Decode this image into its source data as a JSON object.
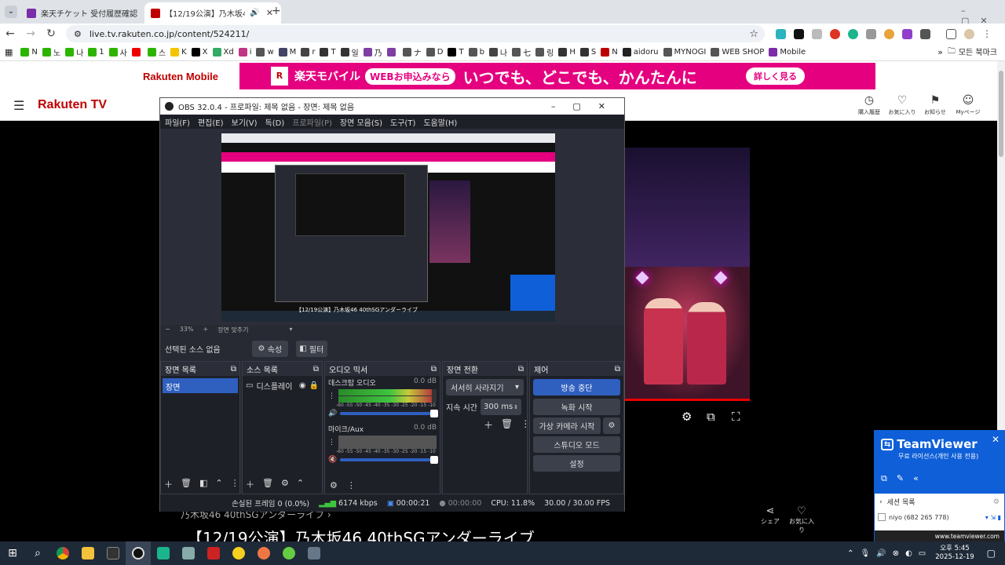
{
  "browser": {
    "tabs": [
      {
        "title": "楽天チケット 受付履歴確認 ·",
        "favicon_color": "#7b2ca8",
        "active": false
      },
      {
        "title": "【12/19公演】乃木坂46 40th",
        "favicon_color": "#bf0000",
        "active": true,
        "audio_icon": "speaker-icon"
      }
    ],
    "new_tab_label": "+",
    "url": "live.tv.rakuten.co.jp/content/524211/",
    "bookmarks": [
      {
        "label": "N",
        "color": "#2db400"
      },
      {
        "label": "노",
        "color": "#2db400"
      },
      {
        "label": "나",
        "color": "#2db400"
      },
      {
        "label": "1",
        "color": "#2db400"
      },
      {
        "label": "사",
        "color": "#2db400"
      },
      {
        "label": "",
        "color": "#e00"
      },
      {
        "label": "스",
        "color": "#2db400"
      },
      {
        "label": "K",
        "color": "#f5c400"
      },
      {
        "label": "X",
        "color": "#000"
      },
      {
        "label": "Xd",
        "color": "#3a6"
      },
      {
        "label": "i",
        "color": "#c13584"
      },
      {
        "label": "w",
        "color": "#555"
      },
      {
        "label": "M",
        "color": "#446"
      },
      {
        "label": "r",
        "color": "#444"
      },
      {
        "label": "T",
        "color": "#333"
      },
      {
        "label": "일",
        "color": "#333"
      },
      {
        "label": "乃",
        "color": "#7e3fa0"
      },
      {
        "label": "",
        "color": "#7e3fa0"
      },
      {
        "label": "ナ",
        "color": "#555"
      },
      {
        "label": "D",
        "color": "#555"
      },
      {
        "label": "T",
        "color": "#000"
      },
      {
        "label": "b",
        "color": "#555"
      },
      {
        "label": "나",
        "color": "#444"
      },
      {
        "label": "七",
        "color": "#555"
      },
      {
        "label": "링",
        "color": "#555"
      },
      {
        "label": "H",
        "color": "#333"
      },
      {
        "label": "S",
        "color": "#333"
      },
      {
        "label": "N",
        "color": "#b00"
      },
      {
        "label": "aidoru",
        "color": "#222"
      },
      {
        "label": "MYNOGI",
        "color": "#555"
      },
      {
        "label": "WEB SHOP",
        "color": "#555"
      },
      {
        "label": "Mobile",
        "color": "#7b2ca8"
      }
    ],
    "more_bookmarks": "모든 북마크"
  },
  "banner": {
    "brand": "Rakuten Mobile",
    "text1": "楽天モバイル",
    "text2": "WEBお申込みなら",
    "text3": "いつでも、どこでも、かんたんに",
    "cta": "詳しく見る"
  },
  "site": {
    "logo": "Rakuten TV",
    "nav": [
      {
        "label": "購入履歴",
        "icon": "history-icon"
      },
      {
        "label": "お気に入り",
        "icon": "heart-icon"
      },
      {
        "label": "お知らせ",
        "icon": "notice-icon"
      },
      {
        "label": "Myページ",
        "icon": "mypage-icon"
      }
    ],
    "breadcrumb": "乃木坂46 40thSGアンダーライブ ›",
    "title": "【12/19公演】乃木坂46 40thSGアンダーライブ",
    "share": "シェア",
    "favorite": "お気に入り"
  },
  "obs": {
    "window_title": "OBS 32.0.4 - 프로파일: 제목 없음 - 장면: 제목 없음",
    "menu": [
      "파일(F)",
      "편집(E)",
      "보기(V)",
      "독(D)",
      "프로파일(P)",
      "장면 모음(S)",
      "도구(T)",
      "도움말(H)"
    ],
    "zoom": "33%",
    "zoom_fit": "장면 맞추기",
    "inner_caption": "【12/19公演】乃木坂46 40thSGアンダーライブ",
    "no_source": "선택된 소스 없음",
    "properties": "속성",
    "filters": "필터",
    "docks": {
      "scenes": {
        "title": "장면 목록",
        "items": [
          "장면"
        ]
      },
      "sources": {
        "title": "소스 목록",
        "items": [
          "디스플레이"
        ]
      },
      "mixer": {
        "title": "오디오 믹서",
        "channels": [
          {
            "name": "데스크탑 오디오",
            "db": "0.0 dB",
            "level": 0.95
          },
          {
            "name": "마이크/Aux",
            "db": "0.0 dB",
            "level": 0.0
          }
        ],
        "scale": "-60 -55 -50 -45 -40 -35 -30 -25 -20 -15 -10 -5 0"
      },
      "transitions": {
        "title": "장면 전환",
        "type": "서서히 사라지기",
        "duration_label": "지속 시간",
        "duration": "300 ms"
      },
      "controls": {
        "title": "제어",
        "buttons": [
          "방송 중단",
          "녹화 시작",
          "가상 카메라 시작",
          "스튜디오 모드",
          "설정"
        ]
      }
    },
    "status": {
      "dropped": "손실된 프레임 0 (0.0%)",
      "bitrate": "6174 kbps",
      "stream_time": "00:00:21",
      "rec_time": "00:00:00",
      "cpu": "CPU: 11.8%",
      "fps": "30.00 / 30.00 FPS"
    }
  },
  "teamviewer": {
    "title": "TeamViewer",
    "subtitle": "무료 라이선스(개인 사용 전용)",
    "session_list": "세션 목록",
    "session": "niyo (682 265 778)",
    "url": "www.teamviewer.com"
  },
  "taskbar": {
    "time": "오후 5:45",
    "date": "2025-12-19"
  }
}
